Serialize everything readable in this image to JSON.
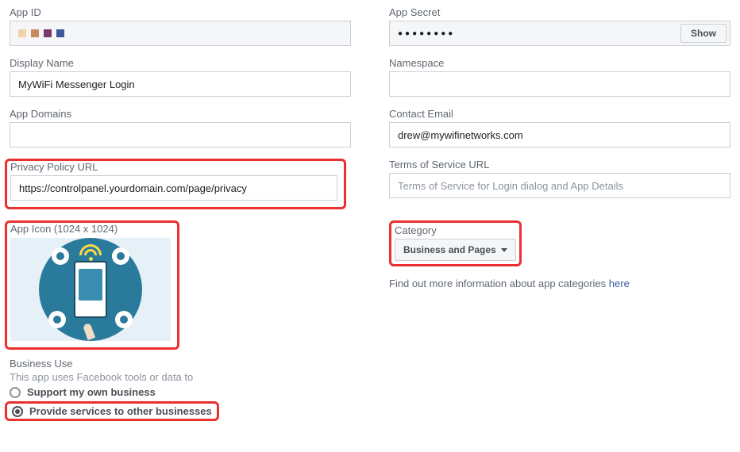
{
  "row1": {
    "appId": {
      "label": "App ID"
    },
    "appSecret": {
      "label": "App Secret",
      "value": "●●●●●●●●",
      "showLabel": "Show"
    }
  },
  "row2": {
    "displayName": {
      "label": "Display Name",
      "value": "MyWiFi Messenger Login"
    },
    "namespace": {
      "label": "Namespace",
      "value": ""
    }
  },
  "row3": {
    "appDomains": {
      "label": "App Domains",
      "value": ""
    },
    "contactEmail": {
      "label": "Contact Email",
      "value": "drew@mywifinetworks.com"
    }
  },
  "row4": {
    "privacy": {
      "label": "Privacy Policy URL",
      "value": "https://controlpanel.yourdomain.com/page/privacy"
    },
    "terms": {
      "label": "Terms of Service URL",
      "placeholder": "Terms of Service for Login dialog and App Details",
      "value": ""
    }
  },
  "row5": {
    "appIcon": {
      "label": "App Icon (1024 x 1024)"
    },
    "category": {
      "label": "Category",
      "selected": "Business and Pages",
      "infoPrefix": "Find out more information about app categories ",
      "infoLink": "here"
    }
  },
  "businessUse": {
    "label": "Business Use",
    "description": "This app uses Facebook tools or data to",
    "option1": "Support my own business",
    "option2": "Provide services to other businesses",
    "selected": "option2"
  }
}
